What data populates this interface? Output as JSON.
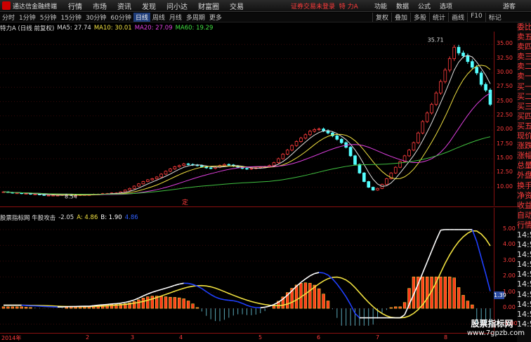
{
  "topbar": {
    "app_name": "通达信金融终端",
    "menu": [
      "行情",
      "市场",
      "资讯",
      "发现",
      "问小达",
      "财富圈",
      "交易"
    ],
    "notice": "证券交易未登录",
    "stock_name": "特 力A",
    "right_menu": [
      "功能",
      "数据",
      "公式",
      "选项"
    ],
    "guest": "游客"
  },
  "period_bar": {
    "periods": [
      "分时",
      "1分钟",
      "5分钟",
      "15分钟",
      "30分钟",
      "60分钟",
      "日线",
      "周线",
      "月线",
      "多周期",
      "更多"
    ],
    "active": "日线",
    "tools": [
      "复权",
      "叠加",
      "多股",
      "统计",
      "画线",
      "F10",
      "标记"
    ]
  },
  "info": {
    "title": "特力A (日线 前复权)",
    "ma5": "MA5: 27.74",
    "ma10": "MA10: 30.01",
    "ma20": "MA20: 27.09",
    "ma60": "MA60: 19.29"
  },
  "price_axis": [
    "35.00",
    "32.50",
    "30.00",
    "27.50",
    "25.00",
    "22.50",
    "20.00",
    "17.50",
    "15.00",
    "12.50",
    "10.00"
  ],
  "price_labels": {
    "high": "35.71",
    "low": "8.54",
    "marker": "定"
  },
  "side_panel": [
    "委比",
    "卖五",
    "卖四",
    "卖三",
    "卖二",
    "卖一",
    "买一",
    "买二",
    "买三",
    "买四",
    "买五",
    "现价",
    "涨跌",
    "涨幅",
    "总量",
    "外盘",
    "换手",
    "净资",
    "收益",
    "自动",
    "行情",
    "14:5",
    "14:5",
    "14:5",
    "14:5",
    "14:5",
    "14:5",
    "14:5",
    "14:5",
    "14:5",
    "14:5"
  ],
  "indicator": {
    "title": "股票指标网 牛股攻击",
    "v1": "-2.05",
    "a": "A: 4.86",
    "b": "B: 1.90",
    "c": "4.86",
    "axis": [
      "5.00",
      "4.00",
      "3.00",
      "2.00",
      "1.00",
      "0.00",
      "-1.00"
    ],
    "badge": "1.39"
  },
  "xaxis": [
    "2014年",
    "2",
    "3",
    "4",
    "5",
    "6",
    "7",
    "8"
  ],
  "watermark": {
    "line1": "股票指标网",
    "line2": "www.7gpzb.com"
  },
  "chart_data": {
    "type": "candlestick",
    "ylim": [
      7.5,
      36.5
    ],
    "x_months": [
      "2014年",
      "2",
      "3",
      "4",
      "5",
      "6",
      "7",
      "8"
    ],
    "close": [
      9.2,
      9.1,
      9.0,
      9.0,
      8.9,
      8.9,
      8.8,
      8.8,
      8.7,
      8.6,
      8.6,
      8.6,
      8.6,
      8.7,
      8.7,
      8.6,
      8.6,
      8.7,
      8.7,
      8.7,
      8.8,
      8.8,
      8.9,
      8.9,
      9.0,
      9.0,
      9.2,
      9.5,
      9.8,
      10.2,
      10.6,
      11.0,
      11.3,
      11.5,
      11.8,
      12.3,
      12.8,
      13.2,
      13.6,
      13.8,
      14.1,
      14.0,
      13.9,
      13.8,
      13.6,
      13.4,
      13.3,
      13.5,
      13.8,
      14.0,
      13.9,
      13.7,
      13.5,
      13.3,
      13.2,
      13.3,
      13.4,
      13.5,
      13.6,
      13.8,
      14.3,
      15.0,
      15.8,
      16.5,
      17.3,
      18.0,
      18.6,
      19.2,
      19.8,
      20.1,
      20.2,
      19.9,
      19.5,
      19.0,
      18.4,
      17.8,
      17.0,
      15.5,
      14.0,
      12.5,
      11.0,
      10.0,
      9.5,
      9.8,
      10.5,
      11.5,
      12.5,
      13.5,
      14.5,
      15.5,
      16.5,
      17.8,
      19.5,
      21.5,
      23.0,
      24.5,
      26.5,
      28.5,
      30.5,
      32.5,
      34.5,
      33.5,
      33.0,
      32.0,
      31.0,
      30.0,
      28.0,
      27.0,
      24.5
    ],
    "ma_lines": [
      "MA5",
      "MA10",
      "MA20",
      "MA60"
    ]
  }
}
